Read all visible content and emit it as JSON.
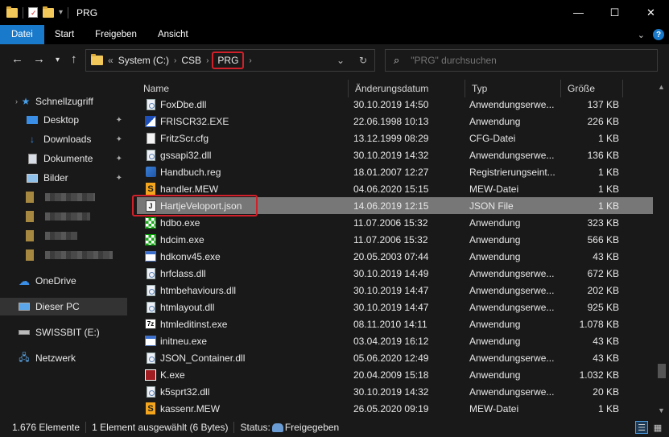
{
  "window": {
    "title": "PRG"
  },
  "ribbon": {
    "tabs": [
      "Datei",
      "Start",
      "Freigeben",
      "Ansicht"
    ]
  },
  "address": {
    "overflow": "«",
    "crumbs": [
      "System (C:)",
      "CSB",
      "PRG"
    ]
  },
  "search": {
    "placeholder": "\"PRG\" durchsuchen"
  },
  "nav": {
    "quick_access": "Schnellzugriff",
    "items": [
      {
        "label": "Desktop",
        "icon": "desktop-icon"
      },
      {
        "label": "Downloads",
        "icon": "download-icon"
      },
      {
        "label": "Dokumente",
        "icon": "documents-icon"
      },
      {
        "label": "Bilder",
        "icon": "pictures-icon"
      }
    ],
    "onedrive": "OneDrive",
    "this_pc": "Dieser PC",
    "usb": "SWISSBIT (E:)",
    "network": "Netzwerk"
  },
  "columns": {
    "name": "Name",
    "date": "Änderungsdatum",
    "type": "Typ",
    "size": "Größe"
  },
  "files": [
    {
      "name": "FoxDbe.dll",
      "date": "30.10.2019 14:50",
      "type": "Anwendungserwe...",
      "size": "137 KB",
      "icon": "gear"
    },
    {
      "name": "FRISCR32.EXE",
      "date": "22.06.1998 10:13",
      "type": "Anwendung",
      "size": "226 KB",
      "icon": "frisc"
    },
    {
      "name": "FritzScr.cfg",
      "date": "13.12.1999 08:29",
      "type": "CFG-Datei",
      "size": "1 KB",
      "icon": "doc"
    },
    {
      "name": "gssapi32.dll",
      "date": "30.10.2019 14:32",
      "type": "Anwendungserwe...",
      "size": "136 KB",
      "icon": "gear"
    },
    {
      "name": "Handbuch.reg",
      "date": "18.01.2007 12:27",
      "type": "Registrierungseint...",
      "size": "1 KB",
      "icon": "reg"
    },
    {
      "name": "handler.MEW",
      "date": "04.06.2020 15:15",
      "type": "MEW-Datei",
      "size": "1 KB",
      "icon": "mew"
    },
    {
      "name": "HartjeVeloport.json",
      "date": "14.06.2019 12:15",
      "type": "JSON File",
      "size": "1 KB",
      "icon": "json",
      "selected": true
    },
    {
      "name": "hdbo.exe",
      "date": "11.07.2006 15:32",
      "type": "Anwendung",
      "size": "323 KB",
      "icon": "green"
    },
    {
      "name": "hdcim.exe",
      "date": "11.07.2006 15:32",
      "type": "Anwendung",
      "size": "566 KB",
      "icon": "green"
    },
    {
      "name": "hdkonv45.exe",
      "date": "20.05.2003 07:44",
      "type": "Anwendung",
      "size": "43 KB",
      "icon": "exe"
    },
    {
      "name": "hrfclass.dll",
      "date": "30.10.2019 14:49",
      "type": "Anwendungserwe...",
      "size": "672 KB",
      "icon": "gear"
    },
    {
      "name": "htmbehaviours.dll",
      "date": "30.10.2019 14:47",
      "type": "Anwendungserwe...",
      "size": "202 KB",
      "icon": "gear"
    },
    {
      "name": "htmlayout.dll",
      "date": "30.10.2019 14:47",
      "type": "Anwendungserwe...",
      "size": "925 KB",
      "icon": "gear"
    },
    {
      "name": "htmleditinst.exe",
      "date": "08.11.2010 14:11",
      "type": "Anwendung",
      "size": "1.078 KB",
      "icon": "7z"
    },
    {
      "name": "initneu.exe",
      "date": "03.04.2019 16:12",
      "type": "Anwendung",
      "size": "43 KB",
      "icon": "exe"
    },
    {
      "name": "JSON_Container.dll",
      "date": "05.06.2020 12:49",
      "type": "Anwendungserwe...",
      "size": "43 KB",
      "icon": "gear"
    },
    {
      "name": "K.exe",
      "date": "20.04.2009 15:18",
      "type": "Anwendung",
      "size": "1.032 KB",
      "icon": "k"
    },
    {
      "name": "k5sprt32.dll",
      "date": "30.10.2019 14:32",
      "type": "Anwendungserwe...",
      "size": "20 KB",
      "icon": "gear"
    },
    {
      "name": "kassenr.MEW",
      "date": "26.05.2020 09:19",
      "type": "MEW-Datei",
      "size": "1 KB",
      "icon": "mew"
    }
  ],
  "status": {
    "count": "1.676 Elemente",
    "selection": "1 Element ausgewählt (6 Bytes)",
    "state_label": "Status:",
    "state_value": "Freigegeben"
  }
}
